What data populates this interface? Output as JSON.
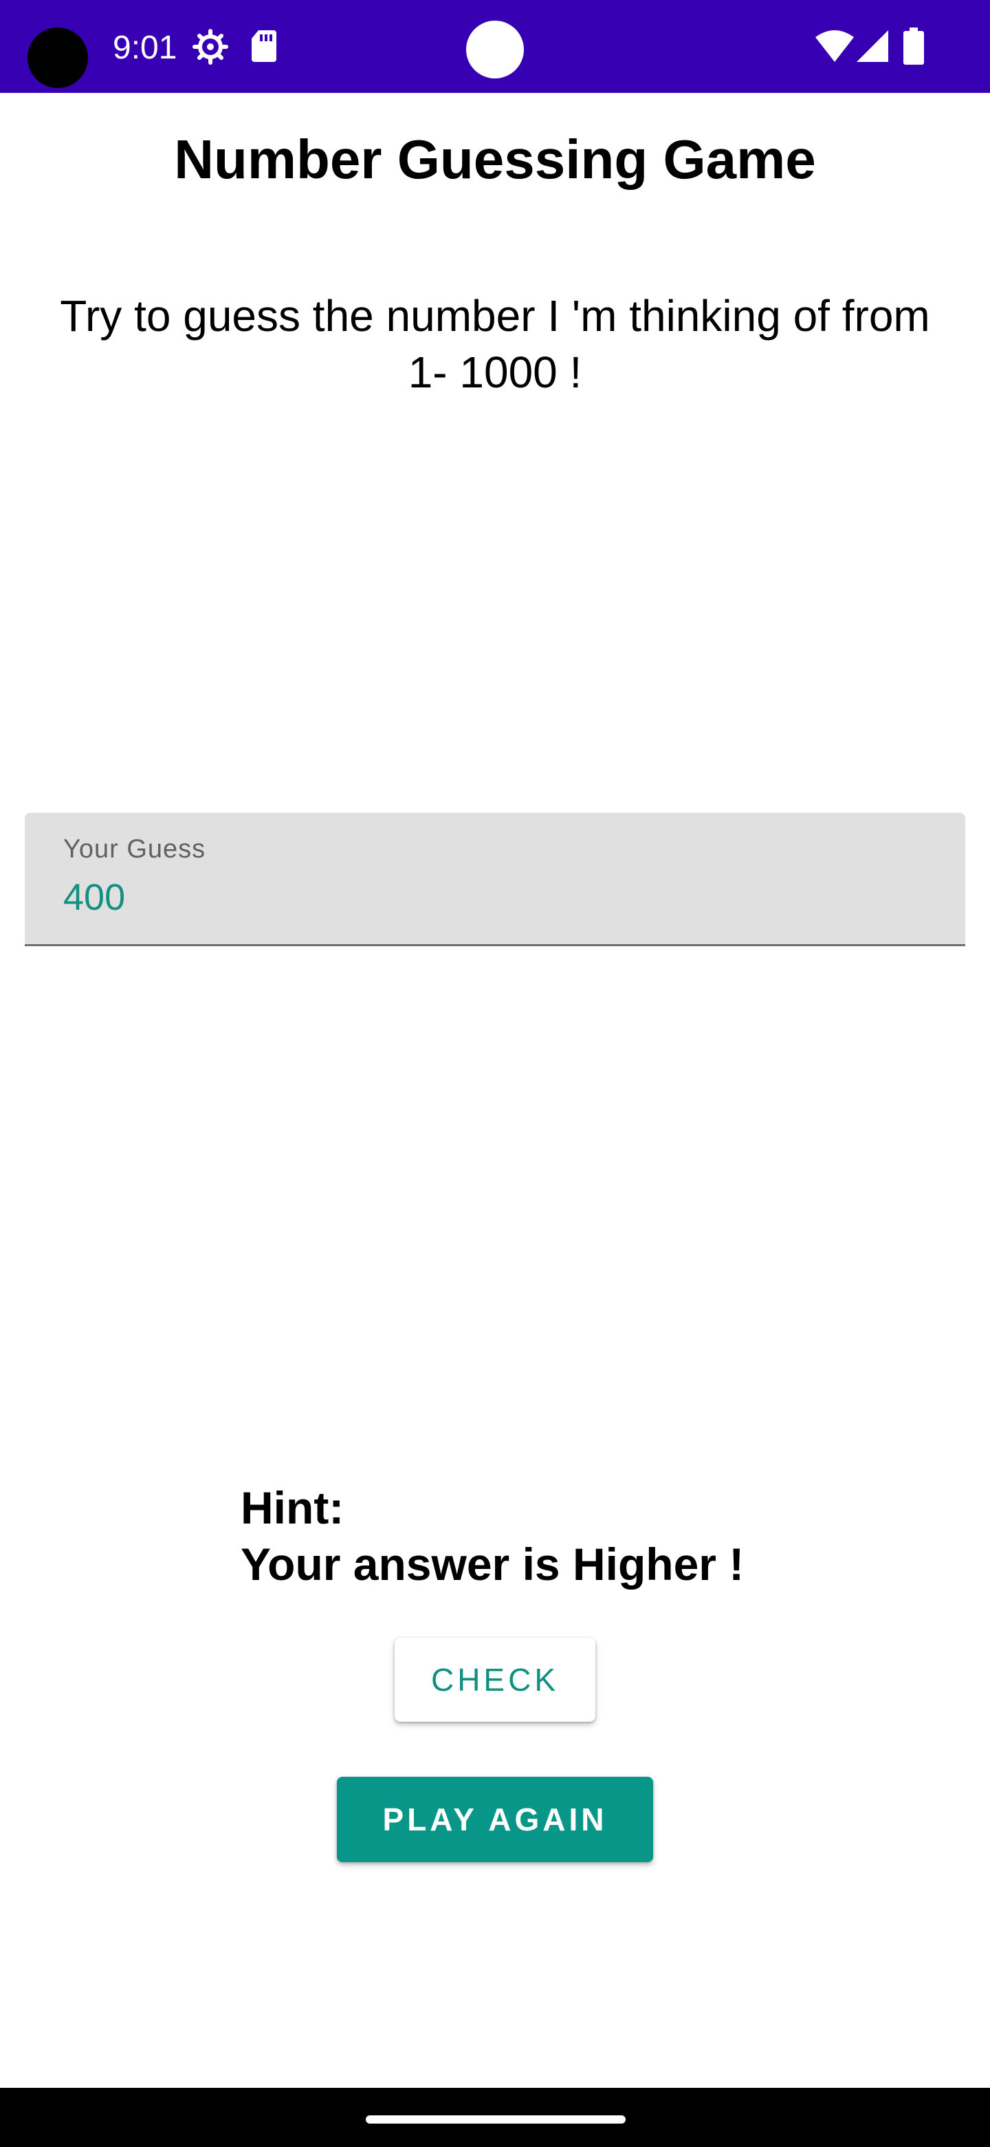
{
  "status_bar": {
    "time": "9:01",
    "background": "#3700b3",
    "icons": [
      "settings-gear-icon",
      "sd-card-icon",
      "wifi-icon",
      "cell-signal-icon",
      "battery-icon"
    ]
  },
  "game": {
    "title": "Number Guessing Game",
    "instructions": "Try to guess the number I 'm thinking of from 1- 1000 !"
  },
  "guess_field": {
    "label": "Your Guess",
    "value": "400"
  },
  "hint": {
    "heading": "Hint:",
    "message": "Your answer is Higher !"
  },
  "buttons": {
    "check_label": "CHECK",
    "play_again_label": "PLAY AGAIN"
  },
  "colors": {
    "accent": "#079688",
    "status_bar": "#3700b3"
  }
}
